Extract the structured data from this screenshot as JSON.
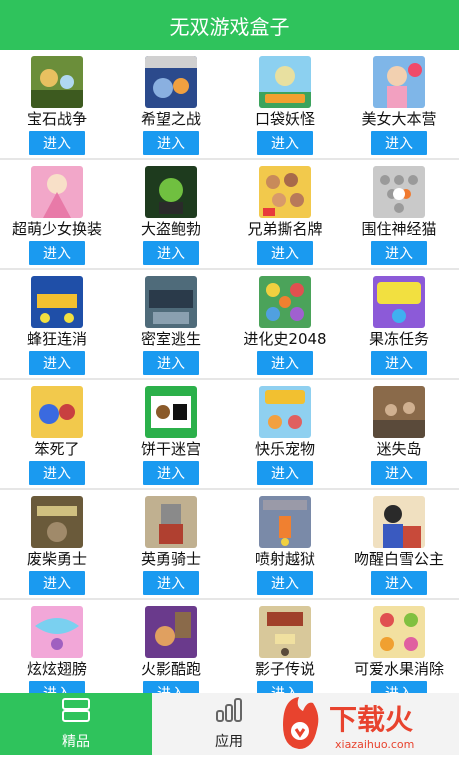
{
  "header": {
    "title": "无双游戏盒子"
  },
  "games": [
    [
      {
        "name": "宝石战争",
        "button": "进入",
        "color": "#6b8e3a"
      },
      {
        "name": "希望之战",
        "button": "进入",
        "color": "#2b4a8c"
      },
      {
        "name": "口袋妖怪",
        "button": "进入",
        "color": "#3da35d"
      },
      {
        "name": "美女大本营",
        "button": "进入",
        "color": "#7fb6e8"
      }
    ],
    [
      {
        "name": "超萌少女换装",
        "button": "进入",
        "color": "#f2a7c9"
      },
      {
        "name": "大盗鲍勃",
        "button": "进入",
        "color": "#1e3b1e"
      },
      {
        "name": "兄弟撕名牌",
        "button": "进入",
        "color": "#f2c94c"
      },
      {
        "name": "围住神经猫",
        "button": "进入",
        "color": "#c9c9c9"
      }
    ],
    [
      {
        "name": "蜂狂连消",
        "button": "进入",
        "color": "#1f4fa8"
      },
      {
        "name": "密室逃生",
        "button": "进入",
        "color": "#4f6b7a"
      },
      {
        "name": "进化史2048",
        "button": "进入",
        "color": "#4ba35a"
      },
      {
        "name": "果冻任务",
        "button": "进入",
        "color": "#8c5ad8"
      }
    ],
    [
      {
        "name": "笨死了",
        "button": "进入",
        "color": "#f2c94c"
      },
      {
        "name": "饼干迷宫",
        "button": "进入",
        "color": "#2bb04a"
      },
      {
        "name": "快乐宠物",
        "button": "进入",
        "color": "#8fd0f0"
      },
      {
        "name": "迷失岛",
        "button": "进入",
        "color": "#8a6a4a"
      }
    ],
    [
      {
        "name": "废柴勇士",
        "button": "进入",
        "color": "#6a5a3a"
      },
      {
        "name": "英勇骑士",
        "button": "进入",
        "color": "#8c7a5a"
      },
      {
        "name": "喷射越狱",
        "button": "进入",
        "color": "#7a8aa8"
      },
      {
        "name": "吻醒白雪公主",
        "button": "进入",
        "color": "#c84a3a"
      }
    ],
    [
      {
        "name": "炫炫翅膀",
        "button": "进入",
        "color": "#f2a7d8"
      },
      {
        "name": "火影酷跑",
        "button": "进入",
        "color": "#6a3a8c"
      },
      {
        "name": "影子传说",
        "button": "进入",
        "color": "#d8c89a"
      },
      {
        "name": "可爱水果消除",
        "button": "进入",
        "color": "#f2e0a0"
      }
    ]
  ],
  "tabs": [
    {
      "label": "精品",
      "icon": "grid-icon",
      "active": true
    },
    {
      "label": "应用",
      "icon": "bar-chart-icon",
      "active": false
    }
  ],
  "watermark": {
    "text": "下载火",
    "domain": "xiazaihuo.com",
    "color": "#e8432e"
  }
}
